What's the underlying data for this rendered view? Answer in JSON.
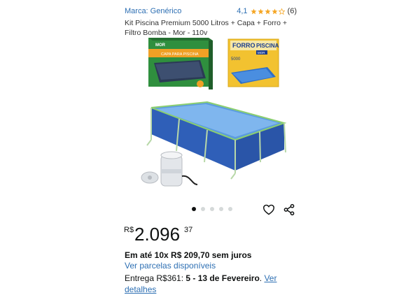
{
  "header": {
    "brand": "Marca: Genérico",
    "rating_value": "4,1",
    "rating_stars": 4.1,
    "rating_count": "(6)"
  },
  "product": {
    "title": "Kit Piscina Premium 5000 Litros + Capa + Forro + Filtro Bomba - Mor - 110v",
    "image_box1_brand": "MOR",
    "image_box1_label": "CAPA PARA PISCINA",
    "image_box2_title1": "FORRO",
    "image_box2_title2": "PISCINA",
    "image_box2_brand": "MOR",
    "image_box2_capacity": "5000"
  },
  "gallery": {
    "dot_count": 5,
    "active_index": 0
  },
  "actions": {
    "favorite_icon": "heart-icon",
    "share_icon": "share-icon"
  },
  "price": {
    "currency": "R$",
    "whole": "2.096",
    "cents": "37"
  },
  "installments_text": "Em até 10x R$ 209,70 sem juros",
  "installments_link": "Ver parcelas disponíveis",
  "delivery": {
    "prefix": "Entrega R$361: ",
    "dates": "5 - 13 de Fevereiro",
    "suffix": ". ",
    "link": "Ver detalhes"
  },
  "colors": {
    "link": "#2d6fb3",
    "star": "#f5a623",
    "text": "#0f1111"
  }
}
